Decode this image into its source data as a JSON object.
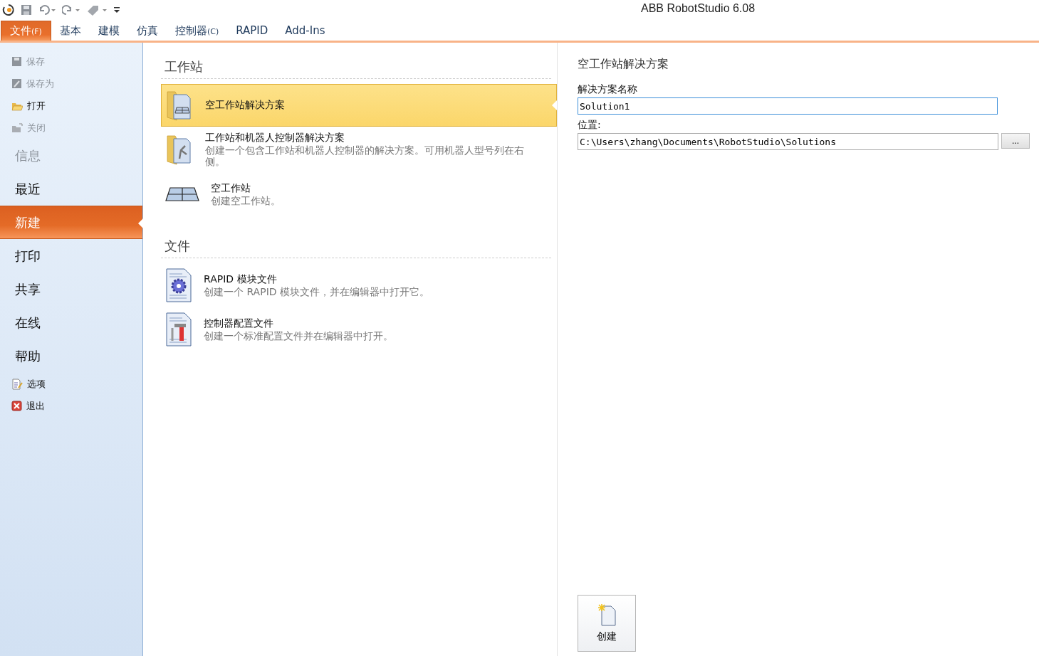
{
  "window": {
    "title": "ABB RobotStudio 6.08"
  },
  "quick_access": [
    {
      "kind": "app"
    },
    {
      "kind": "save"
    },
    {
      "kind": "undo"
    },
    {
      "kind": "redo"
    },
    {
      "kind": "tag"
    },
    {
      "kind": "customize"
    }
  ],
  "tabs": [
    {
      "label": "文件",
      "key": "(F)",
      "selected": true
    },
    {
      "label": "基本",
      "selected": false
    },
    {
      "label": "建模",
      "selected": false
    },
    {
      "label": "仿真",
      "selected": false
    },
    {
      "label": "控制器",
      "key": "(C)",
      "selected": false
    },
    {
      "label": "RAPID",
      "selected": false
    },
    {
      "label": "Add-Ins",
      "selected": false
    }
  ],
  "sidebar": {
    "items": [
      {
        "kind": "save",
        "label": "保存",
        "disabled": true
      },
      {
        "kind": "saveas",
        "label": "保存为",
        "disabled": true
      },
      {
        "kind": "open",
        "label": "打开",
        "disabled": false
      },
      {
        "kind": "close",
        "label": "关闭",
        "disabled": true
      },
      {
        "kind": "large",
        "label": "信息",
        "disabled": true,
        "selected": false
      },
      {
        "kind": "large",
        "label": "最近",
        "disabled": false,
        "selected": false
      },
      {
        "kind": "large",
        "label": "新建",
        "disabled": false,
        "selected": true
      },
      {
        "kind": "large",
        "label": "打印",
        "disabled": false,
        "selected": false
      },
      {
        "kind": "large",
        "label": "共享",
        "disabled": false,
        "selected": false
      },
      {
        "kind": "large",
        "label": "在线",
        "disabled": false,
        "selected": false
      },
      {
        "kind": "large",
        "label": "帮助",
        "disabled": false,
        "selected": false
      },
      {
        "kind": "options",
        "label": "选项",
        "disabled": false
      },
      {
        "kind": "exit",
        "label": "退出",
        "disabled": false
      }
    ]
  },
  "sections": [
    {
      "title": "工作站",
      "items": [
        {
          "kind": "solution",
          "title": "空工作站解决方案",
          "selected": true
        },
        {
          "kind": "robot-solution",
          "title": "工作站和机器人控制器解决方案",
          "description": "创建一个包含工作站和机器人控制器的解决方案。可用机器人型号列在右侧。",
          "selected": false
        },
        {
          "kind": "station",
          "title": "空工作站",
          "description": "创建空工作站。",
          "selected": false
        }
      ]
    },
    {
      "title": "文件",
      "items": [
        {
          "kind": "rapid",
          "title": "RAPID 模块文件",
          "description": "创建一个 RAPID 模块文件，并在编辑器中打开它。",
          "selected": false
        },
        {
          "kind": "config",
          "title": "控制器配置文件",
          "description": "创建一个标准配置文件并在编辑器中打开。",
          "selected": false
        }
      ]
    }
  ],
  "details": {
    "title": "空工作站解决方案",
    "name_label": "解决方案名称",
    "name_value": "Solution1",
    "location_label": "位置:",
    "location_value": "C:\\Users\\zhang\\Documents\\RobotStudio\\Solutions",
    "browse_button": "...",
    "create_button": "创建"
  }
}
